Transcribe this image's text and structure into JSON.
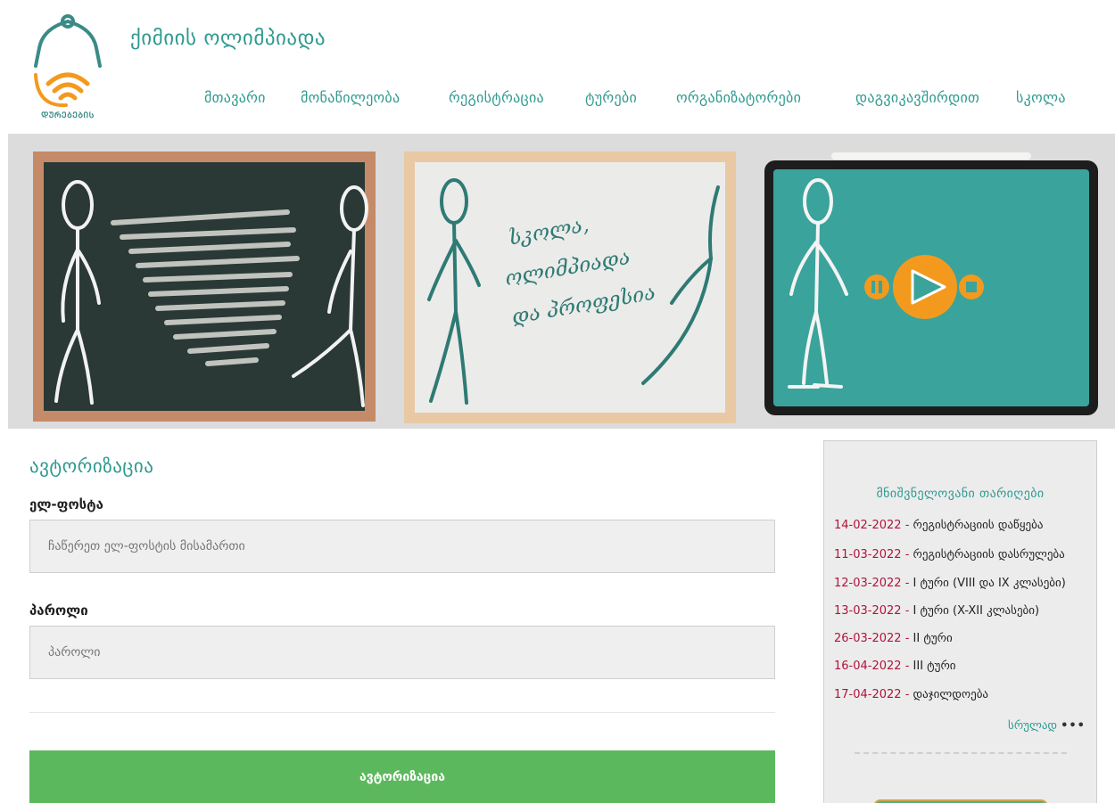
{
  "header": {
    "site_title": "ქიმიის ოლიმპიადა",
    "logo_caption": "ᲓᲣᲠᲔᲑᲔᲑᲘᲡ",
    "nav": [
      {
        "label": "მთავარი"
      },
      {
        "label": "მონაწილეობა"
      },
      {
        "label": "რეგისტრაცია"
      },
      {
        "label": "ტურები"
      },
      {
        "label": "ორგანიზატორები"
      },
      {
        "label": "დაგვიკავშირდით"
      },
      {
        "label": "სკოლა"
      }
    ]
  },
  "banner": {
    "whiteboard_text": [
      "სკოლა,",
      "ოლიმპიადა",
      "და პროფესია"
    ]
  },
  "auth": {
    "title": "ავტორიზაცია",
    "email_label": "ელ-ფოსტა",
    "email_placeholder": "ჩაწერეთ ელ-ფოსტის მისამართი",
    "email_value": "",
    "password_label": "პაროლი",
    "password_placeholder": "პაროლი",
    "password_value": "",
    "submit_label": "ავტორიზაცია"
  },
  "sidebar": {
    "title": "მნიშვნელოვანი თარიღები",
    "dates": [
      {
        "date": "14-02-2022",
        "event": "რეგისტრაციის დაწყება"
      },
      {
        "date": "11-03-2022",
        "event": "რეგისტრაციის დასრულება"
      },
      {
        "date": "12-03-2022",
        "event": "I ტური (VIII და IX კლასები)"
      },
      {
        "date": "13-03-2022",
        "event": "I ტური (X-XII კლასები)"
      },
      {
        "date": "26-03-2022",
        "event": "II ტური"
      },
      {
        "date": "16-04-2022",
        "event": "III ტური"
      },
      {
        "date": "17-04-2022",
        "event": "დაჯილდოება"
      }
    ],
    "more_label": "სრულად",
    "more_dots": "•••"
  },
  "colors": {
    "brand_teal": "#2f9a90",
    "date_red": "#b0143a",
    "button_green": "#5cb85c",
    "logo_orange": "#f39a1e"
  },
  "icons": {
    "play": "play-icon",
    "pause": "pause-icon",
    "stop": "stop-icon"
  }
}
